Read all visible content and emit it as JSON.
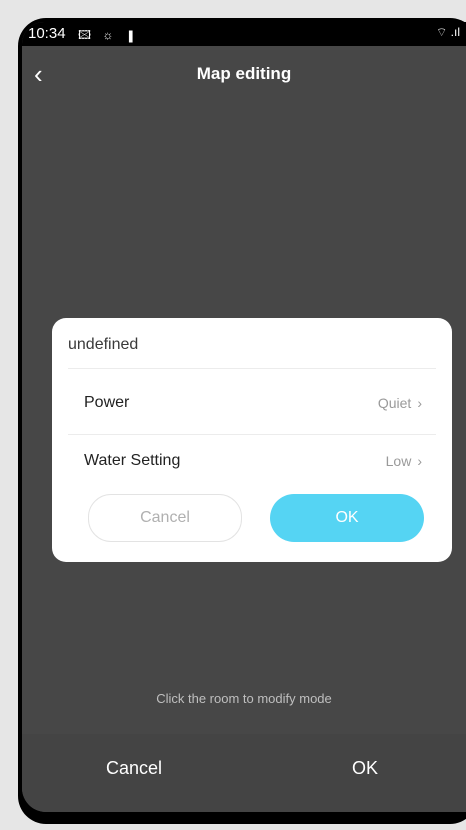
{
  "status_bar": {
    "time": "10:34",
    "left_icons": "🖾 ☼ ▮",
    "right_icons": "⌔ .ıl"
  },
  "header": {
    "back_icon": "‹",
    "title": "Map editing"
  },
  "hint_text": "Click the room to modify mode",
  "bottom_bar": {
    "cancel_label": "Cancel",
    "ok_label": "OK"
  },
  "dialog": {
    "title": "undefined",
    "rows": [
      {
        "label": "Power",
        "value": "Quiet",
        "arrow": "›"
      },
      {
        "label": "Water Setting",
        "value": "Low",
        "arrow": "›"
      }
    ],
    "cancel_label": "Cancel",
    "ok_label": "OK",
    "ok_color": "#55d4f3"
  }
}
